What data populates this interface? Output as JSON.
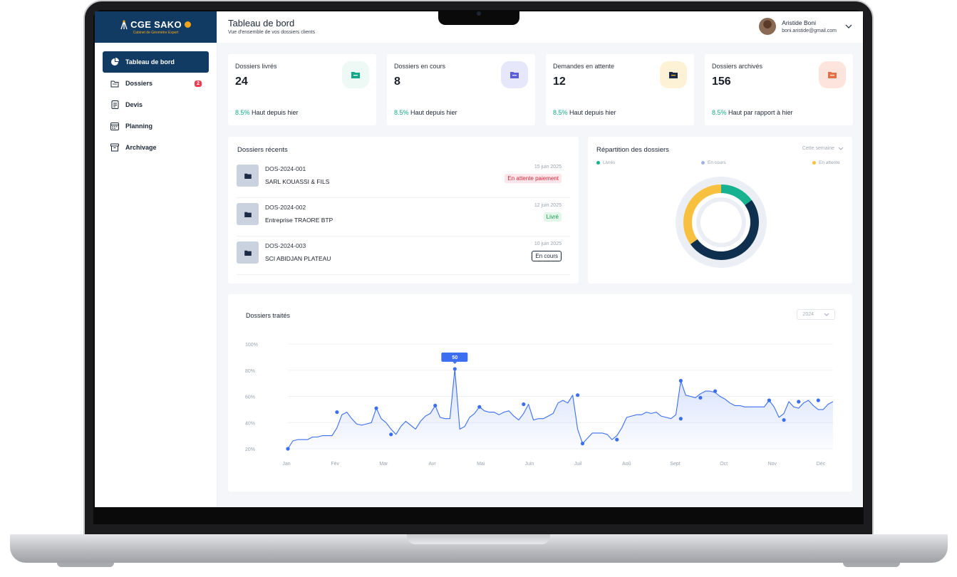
{
  "colors": {
    "brand": "#123b63",
    "accent_green": "#12a88a",
    "chart_line": "#3b6ef0"
  },
  "brand": {
    "name": "CGE SAKO",
    "subtitle": "Cabinet de Géomètre Expert"
  },
  "sidebar": {
    "items": [
      {
        "label": "Tableau de bord",
        "icon": "pie-chart-icon",
        "active": true
      },
      {
        "label": "Dossiers",
        "icon": "folder-icon",
        "badge": "2"
      },
      {
        "label": "Devis",
        "icon": "document-icon"
      },
      {
        "label": "Planning",
        "icon": "calendar-icon"
      },
      {
        "label": "Archivage",
        "icon": "archive-icon"
      }
    ]
  },
  "header": {
    "title": "Tableau de bord",
    "subtitle": "Vue d'ensemble de vos dossiers clients",
    "user_name": "Aristide Boni",
    "user_email": "boni.aristide@gmail.com"
  },
  "stats": [
    {
      "label": "Dossiers livrés",
      "value": "24",
      "pct": "8.5%",
      "trend": " Haut depuis hier",
      "color": "#12a88a"
    },
    {
      "label": "Dossiers en cours",
      "value": "8",
      "pct": "8.5%",
      "trend": " Haut depuis hier",
      "color": "#5b5fd6"
    },
    {
      "label": "Demandes en attente",
      "value": "12",
      "pct": "8.5%",
      "trend": " Haut depuis hier",
      "color": "#c8900e"
    },
    {
      "label": "Dossiers archivés",
      "value": "156",
      "pct": "8.5%",
      "trend": " Haut par rapport à hier",
      "color": "#e0724a"
    }
  ],
  "recent": {
    "title": "Dossiers récents",
    "rows": [
      {
        "code": "DOS-2024-001",
        "name": "SARL KOUASSI & FILS",
        "date": "15 juin 2025",
        "status": "En attente paiement"
      },
      {
        "code": "DOS-2024-002",
        "name": "Entreprise TRAORE BTP",
        "date": "12 juin 2025",
        "status": "Livré"
      },
      {
        "code": "DOS-2024-003",
        "name": "SCI ABIDJAN PLATEAU",
        "date": "10 juin 2025",
        "status": "En cours"
      }
    ]
  },
  "repartition": {
    "title": "Répartition des dossiers",
    "period": "Cette semaine",
    "legend": [
      "Livrés",
      "En cours",
      "En attente"
    ],
    "chart_data": {
      "type": "pie",
      "categories": [
        "Livrés",
        "En cours",
        "En attente"
      ],
      "values": [
        15,
        50,
        35
      ],
      "colors": [
        "#17b28f",
        "#0f2f4f",
        "#f7c13f"
      ]
    }
  },
  "traites": {
    "title": "Dossiers traités",
    "year": "2024",
    "tooltip": "50",
    "chart_data": {
      "type": "area",
      "x": [
        "Jan",
        "",
        "",
        "",
        "",
        "",
        "",
        "",
        "",
        "",
        "Fév",
        "",
        "",
        "",
        "",
        "",
        "",
        "",
        "",
        "",
        "Mar",
        "",
        "",
        "",
        "",
        "",
        "",
        "",
        "",
        "",
        "",
        "Avr",
        "",
        "",
        "",
        "",
        "",
        "",
        "",
        "",
        "",
        "Mai",
        "",
        "",
        "",
        "",
        "",
        "",
        "",
        "",
        "",
        "Juin",
        "",
        "",
        "",
        "",
        "",
        "",
        "",
        "",
        "",
        "Juil",
        "",
        "",
        "",
        "",
        "",
        "",
        "",
        "",
        "",
        "Aoû",
        "",
        "",
        "",
        "",
        "",
        "",
        "",
        "",
        "",
        "Sept",
        "",
        "",
        "",
        "",
        "",
        "",
        "",
        "",
        "",
        "Oct",
        "",
        "",
        "",
        "",
        "",
        "",
        "",
        "",
        "",
        "Nov",
        "",
        "",
        "",
        "",
        "",
        "",
        "",
        "",
        "",
        "Déc",
        "",
        ""
      ],
      "y_labels": [
        "100%",
        "80%",
        "60%",
        "40%",
        "20%"
      ],
      "x_labels": [
        "Jan",
        "Fév",
        "Mar",
        "Avr",
        "Mai",
        "Juin",
        "Juil",
        "Aoû",
        "Sept",
        "Oct",
        "Nov",
        "Déc"
      ],
      "ylim": [
        20,
        100
      ],
      "values": [
        20,
        26,
        27,
        27,
        27,
        29,
        29,
        30,
        30,
        30,
        36,
        46,
        48,
        43,
        39,
        38,
        39,
        40,
        51,
        43,
        40,
        35,
        31,
        37,
        41,
        38,
        35,
        41,
        45,
        47,
        53,
        44,
        43,
        43,
        81,
        35,
        37,
        44,
        47,
        52,
        49,
        48,
        48,
        46,
        48,
        49,
        45,
        42,
        47,
        54,
        42,
        43,
        43,
        45,
        47,
        55,
        57,
        55,
        61,
        35,
        24,
        28,
        32,
        32,
        32,
        31,
        27,
        30,
        36,
        44,
        45,
        46,
        46,
        48,
        47,
        48,
        45,
        44,
        43,
        46,
        72,
        61,
        60,
        59,
        62,
        64,
        64,
        63,
        60,
        58,
        55,
        53,
        53,
        52,
        52,
        52,
        52,
        52,
        57,
        52,
        44,
        47,
        56,
        52,
        51,
        55,
        57,
        53,
        50,
        50,
        54,
        56
      ],
      "markers": [
        [
          0,
          20
        ],
        [
          10,
          48
        ],
        [
          18,
          51
        ],
        [
          21,
          31
        ],
        [
          30,
          53
        ],
        [
          34,
          81
        ],
        [
          39,
          52
        ],
        [
          48,
          54
        ],
        [
          59,
          61
        ],
        [
          60,
          24
        ],
        [
          67,
          27
        ],
        [
          80,
          72
        ],
        [
          80,
          43
        ],
        [
          84,
          59
        ],
        [
          87,
          64
        ],
        [
          98,
          57
        ],
        [
          101,
          42
        ],
        [
          104,
          56
        ],
        [
          108,
          57
        ]
      ]
    }
  }
}
